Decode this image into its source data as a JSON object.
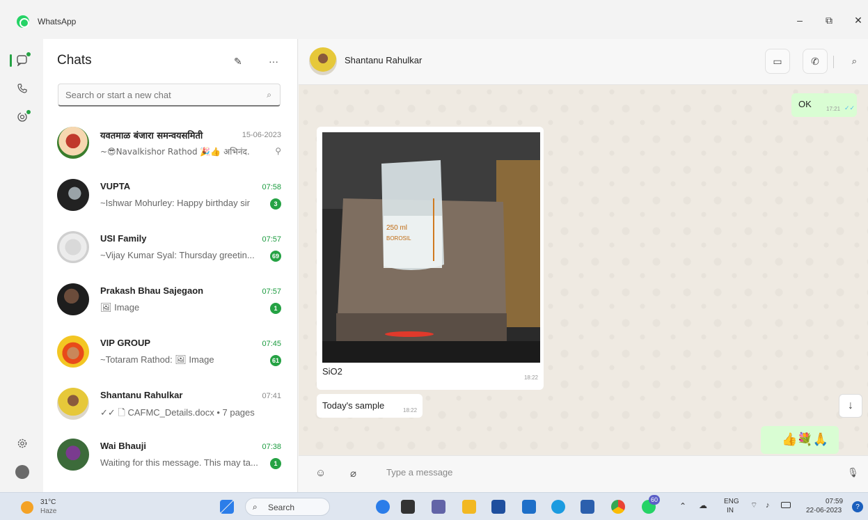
{
  "window": {
    "app_title": "WhatsApp",
    "minimize": "–",
    "maximize": "⧉",
    "close": "✕"
  },
  "rail": {
    "icons": [
      "chats-icon",
      "calls-icon",
      "status-icon",
      "settings-icon",
      "profile-icon"
    ]
  },
  "chatlist": {
    "title": "Chats",
    "new_chat_glyph": "✎",
    "menu_glyph": "···",
    "search_placeholder": "Search or start a new chat",
    "search_glyph": "⌕",
    "items": [
      {
        "name": "यवतमाळ बंजारा समन्वयसमिती",
        "time": "15-06-2023",
        "preview": "~😎Navalkishor Rathod 🎉👍 अभिनंद...",
        "badge": "",
        "pinned": true,
        "pin_glyph": "⚲",
        "unread": false
      },
      {
        "name": "VUPTA",
        "time": "07:58",
        "preview": "~Ishwar Mohurley: Happy birthday sir",
        "badge": "3",
        "pinned": false,
        "unread": true
      },
      {
        "name": "USI Family",
        "time": "07:57",
        "preview": "~Vijay Kumar Syal: Thursday greetin...",
        "badge": "69",
        "pinned": false,
        "unread": true
      },
      {
        "name": "Prakash Bhau Sajegaon",
        "time": "07:57",
        "preview": "🖼 Image",
        "badge": "1",
        "pinned": false,
        "unread": true
      },
      {
        "name": "VIP GROUP",
        "time": "07:45",
        "preview": "~Totaram Rathod: 🖼 Image",
        "badge": "61",
        "pinned": false,
        "unread": true
      },
      {
        "name": "Shantanu Rahulkar",
        "time": "07:41",
        "preview": "✓✓ 🗋 CAFMC_Details.docx • 7 pages",
        "badge": "",
        "pinned": false,
        "unread": false
      },
      {
        "name": "Wai Bhauji",
        "time": "07:38",
        "preview": "Waiting for this message. This may ta...",
        "badge": "1",
        "pinned": false,
        "unread": true
      }
    ]
  },
  "conversation": {
    "contact_name": "Shantanu Rahulkar",
    "video_glyph": "▭",
    "call_glyph": "✆",
    "search_glyph": "⌕",
    "messages": {
      "ok_text": "OK",
      "ok_time": "17:21",
      "ok_ticks": "✓✓",
      "image_caption": "SiO2",
      "image_time": "18:22",
      "image_label_beaker": "250 ml",
      "image_label_brand": "BOROSIL",
      "text_msg": "Today's sample",
      "text_time": "18:22",
      "emoji_msg": "👍💐🙏"
    },
    "scroll_glyph": "↓",
    "composer": {
      "emoji_glyph": "☺",
      "attach_glyph": "⌀",
      "placeholder": "Type a message",
      "mic_glyph": "🎙"
    }
  },
  "taskbar": {
    "weather_temp": "31°C",
    "weather_desc": "Haze",
    "search_label": "Search",
    "lang_line1": "ENG",
    "lang_line2": "IN",
    "clock_time": "07:59",
    "clock_date": "22-06-2023",
    "notif_badge": "60",
    "help_glyph": "?"
  }
}
